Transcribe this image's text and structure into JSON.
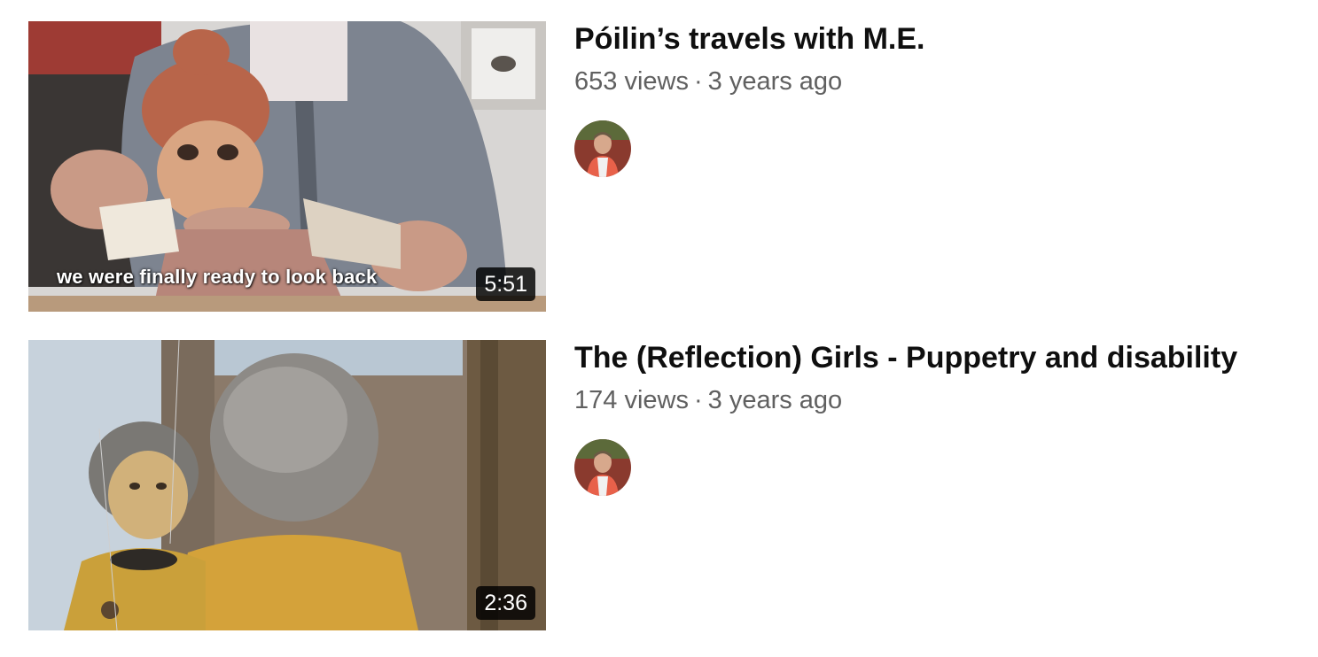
{
  "videos": [
    {
      "title": "Póilin’s travels with M.E.",
      "views": "653 views",
      "separator": "·",
      "age": "3 years ago",
      "duration": "5:51",
      "caption": "we were finally ready to look back"
    },
    {
      "title": "The (Reflection) Girls - Puppetry and disability",
      "views": "174 views",
      "separator": "·",
      "age": "3 years ago",
      "duration": "2:36"
    }
  ],
  "colors": {
    "title": "#0f0f0f",
    "meta": "#606060",
    "badge_bg": "#000000",
    "badge_text": "#ffffff"
  }
}
